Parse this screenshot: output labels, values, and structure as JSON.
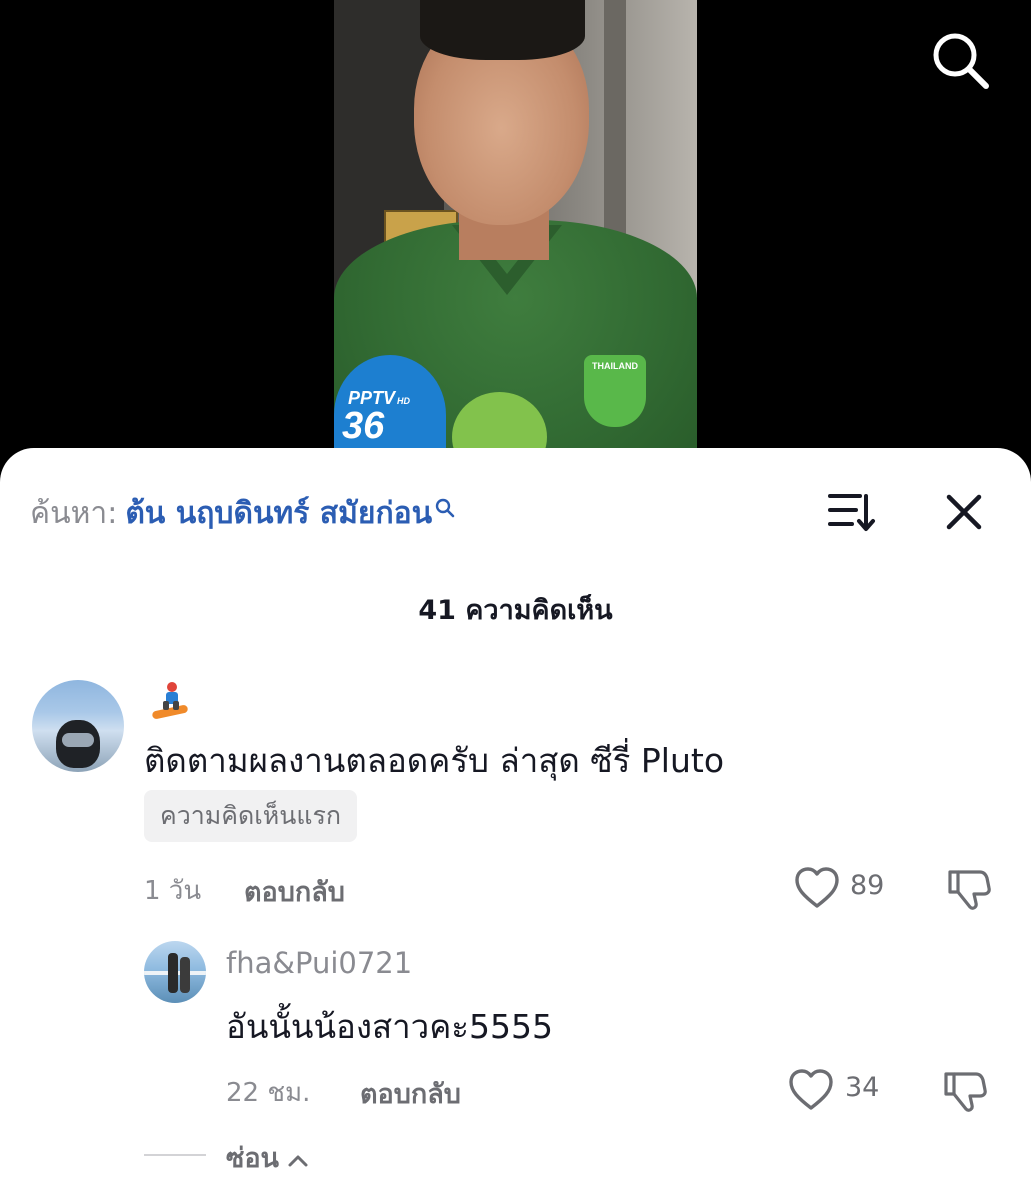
{
  "video": {
    "mic_brand": "PPTV",
    "mic_brand_sub": "HD",
    "mic_channel": "36",
    "shirt_badge": "THAILAND"
  },
  "top_bar": {
    "search_icon": "search-icon"
  },
  "sheet": {
    "search_prefix": "ค้นหา:",
    "search_term": "ต้น นฤบดินทร์ สมัยก่อน",
    "sort_icon": "sort-icon",
    "close_icon": "close-icon",
    "comment_count": "41 ความคิดเห็น"
  },
  "comments": [
    {
      "username_emoji": "🏂",
      "text": "ติดตามผลงานตลอดครับ ล่าสุด ซีรี่ Pluto",
      "badge": "ความคิดเห็นแรก",
      "time": "1 วัน",
      "reply_label": "ตอบกลับ",
      "likes": "89"
    },
    {
      "username": "fha&Pui0721",
      "text": "อันนั้นน้องสาวคะ5555",
      "time": "22 ชม.",
      "reply_label": "ตอบกลับ",
      "likes": "34"
    }
  ],
  "hide_label": "ซ่อน",
  "colors": {
    "link_blue": "#2b5db3",
    "muted": "#8a8b91",
    "text": "#161823"
  }
}
